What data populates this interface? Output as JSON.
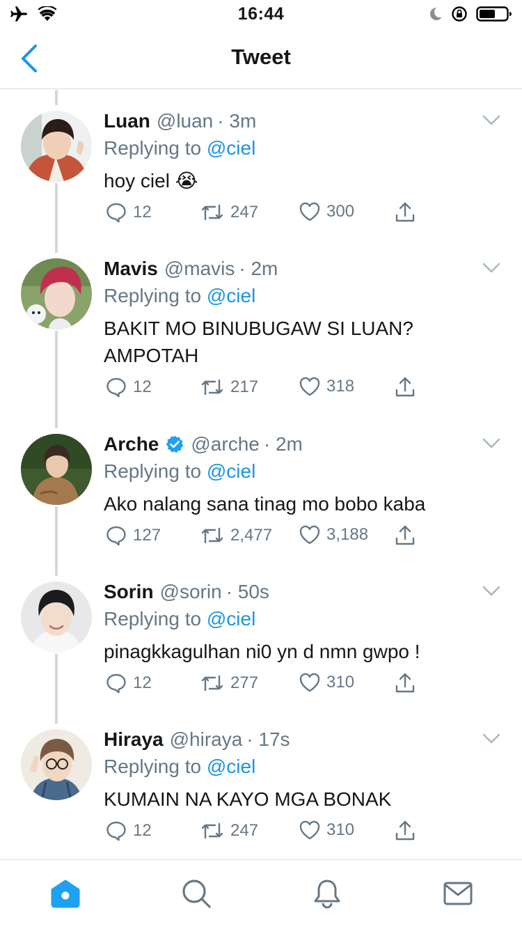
{
  "status_bar": {
    "time": "16:44",
    "left_icons": [
      "airplane-icon",
      "wifi-icon"
    ],
    "right_icons": [
      "moon-icon",
      "rotation-lock-icon",
      "battery-icon"
    ]
  },
  "nav": {
    "back_icon": "chevron-left-icon",
    "title": "Tweet"
  },
  "colors": {
    "accent": "#1b95e0",
    "secondary_text": "#657786",
    "primary_text": "#14171a",
    "thread_line": "#cfd9de",
    "divider": "#d9dde1",
    "verified": "#1da1f2"
  },
  "tweets": [
    {
      "name": "Luan",
      "handle": "@luan",
      "time": "· 3m",
      "reply_prefix": "Replying to",
      "reply_to": "@ciel",
      "text": "hoy ciel 😭",
      "replies": "12",
      "retweets": "247",
      "likes": "300",
      "verified": false
    },
    {
      "name": "Mavis",
      "handle": "@mavis",
      "time": "· 2m",
      "reply_prefix": "Replying to",
      "reply_to": "@ciel",
      "text": "BAKIT MO BINUBUGAW SI LUAN? AMPOTAH",
      "replies": "12",
      "retweets": "217",
      "likes": "318",
      "verified": false
    },
    {
      "name": "Arche",
      "handle": "@arche",
      "time": "· 2m",
      "reply_prefix": "Replying to",
      "reply_to": "@ciel",
      "text": "Ako nalang sana tinag mo bobo kaba",
      "replies": "127",
      "retweets": "2,477",
      "likes": "3,188",
      "verified": true
    },
    {
      "name": "Sorin",
      "handle": "@sorin",
      "time": "· 50s",
      "reply_prefix": "Replying to",
      "reply_to": "@ciel",
      "text": "pinagkkagulhan ni0 yn d nmn gwpo !",
      "replies": "12",
      "retweets": "277",
      "likes": "310",
      "verified": false
    },
    {
      "name": "Hiraya",
      "handle": "@hiraya",
      "time": "· 17s",
      "reply_prefix": "Replying to",
      "reply_to": "@ciel",
      "text": "KUMAIN NA KAYO MGA BONAK",
      "replies": "12",
      "retweets": "247",
      "likes": "310",
      "verified": false
    }
  ],
  "tab_bar": {
    "tabs": [
      "home-icon",
      "search-icon",
      "bell-icon",
      "mail-icon"
    ],
    "active": "home-icon"
  }
}
